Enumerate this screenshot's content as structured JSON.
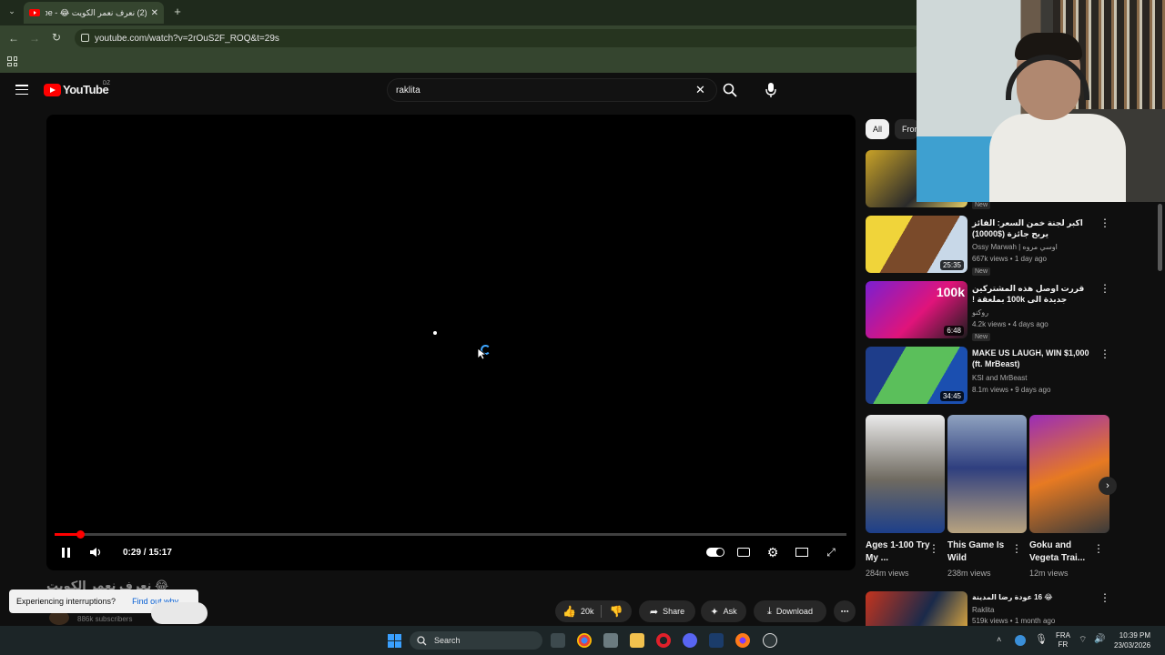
{
  "browser": {
    "tab_title": "(2) نعرف نعمر الكويت 😂 - YouTube",
    "tab_add": "+",
    "url": "youtube.com/watch?v=2rOuS2F_ROQ&t=29s"
  },
  "youtube": {
    "logo_text": "YouTube",
    "logo_region": "DZ",
    "search_value": "raklita"
  },
  "player": {
    "time": "0:29 / 15:17",
    "progress_fraction": 0.032
  },
  "chips": [
    "All",
    "From"
  ],
  "recommendations": [
    {
      "title": "",
      "channel": "",
      "meta": "",
      "badge": "New",
      "duration": ""
    },
    {
      "title": "اكبر لجنة خمن السعر: الفائز يربح جائزة ($10000)",
      "channel": "Ossy Marwah | اوسي مروه",
      "meta": "667k views • 1 day ago",
      "badge": "New",
      "duration": "25:35"
    },
    {
      "title": "قررت اوصل هذه المشتركين جديدة الى 100k بملعقة !",
      "channel": "روكنو",
      "meta": "4.2k views • 4 days ago",
      "badge": "New",
      "duration": "6:48",
      "thumb_text": "100k"
    },
    {
      "title": "MAKE US LAUGH, WIN $1,000 (ft. MrBeast)",
      "channel": "KSI and MrBeast",
      "meta": "8.1m views • 9 days ago",
      "badge": "",
      "duration": "34:45"
    }
  ],
  "shorts": [
    {
      "title": "Ages 1-100 Try My ...",
      "views": "284m views"
    },
    {
      "title": "This Game Is Wild",
      "views": "238m views"
    },
    {
      "title": "Goku and Vegeta Trai...",
      "views": "12m views"
    }
  ],
  "bottom_rec": {
    "title": "😂 16 عودة رضا المدينة",
    "channel": "Raklita",
    "meta": "519k views • 1 month ago"
  },
  "below_video": {
    "video_title": "نعرف نعمر الكويت 😂",
    "subscribers": "886k subscribers",
    "toast_text": "Experiencing interruptions?",
    "toast_link": "Find out why",
    "like_count": "20k",
    "share_label": "Share",
    "ask_label": "Ask",
    "download_label": "Download"
  },
  "taskbar": {
    "search_label": "Search",
    "lang_top": "FRA",
    "lang_bottom": "FR",
    "time": "10:39 PM",
    "date": "23/03/2026"
  },
  "colors": {
    "accent": "#ff0000",
    "browser_frame": "#35452f",
    "link_blue": "#3ea6ff"
  }
}
